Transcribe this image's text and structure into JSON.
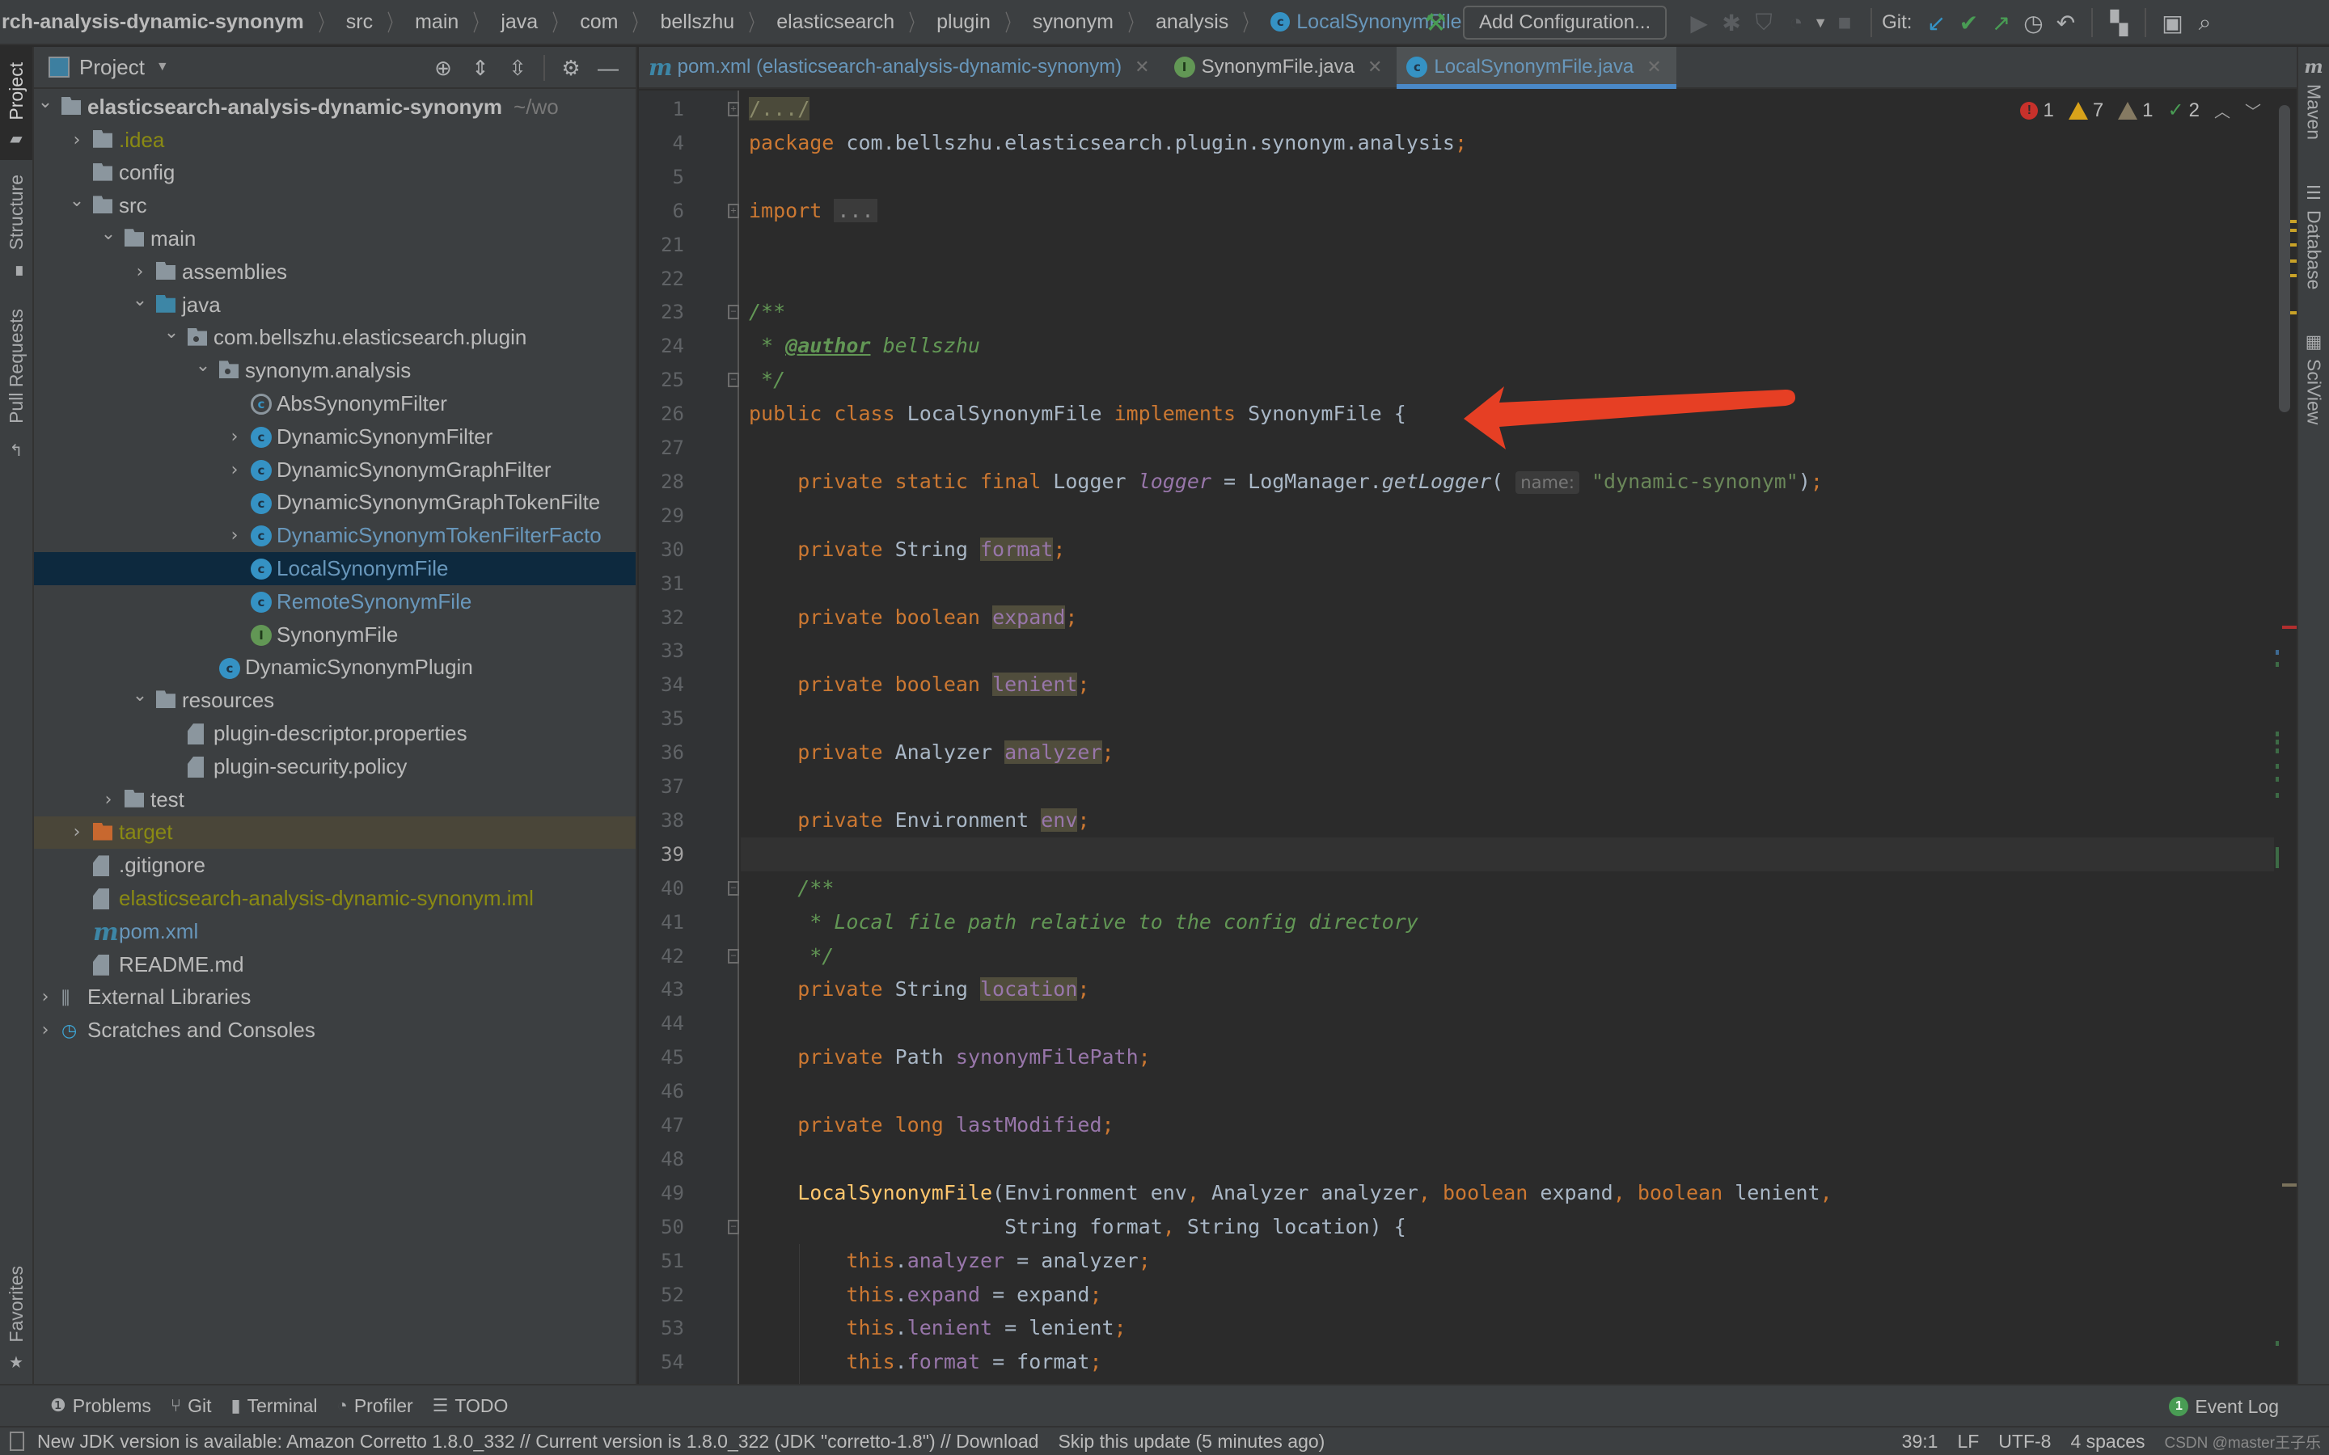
{
  "navbar": {
    "breadcrumbs": [
      "rch-analysis-dynamic-synonym",
      "src",
      "main",
      "java",
      "com",
      "bellszhu",
      "elasticsearch",
      "plugin",
      "synonym",
      "analysis"
    ],
    "current_class": "LocalSynonymFile",
    "add_configuration": "Add Configuration...",
    "git_label": "Git:",
    "icons": [
      "build-hammer-icon",
      "run-icon",
      "debug-icon",
      "coverage-icon",
      "profile-icon",
      "dropdown-icon",
      "stop-icon",
      "git-update-icon",
      "git-commit-icon",
      "git-push-icon",
      "history-icon",
      "rollback-icon",
      "project-structure-icon",
      "run-anything-icon",
      "search-everywhere-icon"
    ]
  },
  "left_strip": {
    "tabs": [
      {
        "label": "Project",
        "active": true
      },
      {
        "label": "Structure",
        "active": false
      },
      {
        "label": "Pull Requests",
        "active": false
      },
      {
        "label": "Favorites",
        "active": false
      }
    ]
  },
  "project_panel": {
    "title": "Project",
    "tree": [
      {
        "label": "elasticsearch-analysis-dynamic-synonym",
        "hint": "~/wo",
        "icon": "module-folder",
        "depth": 0,
        "expanded": true,
        "style": "bold"
      },
      {
        "label": ".idea",
        "icon": "folder",
        "depth": 1,
        "expanded": false,
        "style": "ignored"
      },
      {
        "label": "config",
        "icon": "folder",
        "depth": 1,
        "leaf": true,
        "style": "normal"
      },
      {
        "label": "src",
        "icon": "folder",
        "depth": 1,
        "expanded": true,
        "style": "normal"
      },
      {
        "label": "main",
        "icon": "folder",
        "depth": 2,
        "expanded": true,
        "style": "normal"
      },
      {
        "label": "assemblies",
        "icon": "folder",
        "depth": 3,
        "expanded": false,
        "style": "normal"
      },
      {
        "label": "java",
        "icon": "source-folder",
        "depth": 3,
        "expanded": true,
        "style": "normal"
      },
      {
        "label": "com.bellszhu.elasticsearch.plugin",
        "icon": "package",
        "depth": 4,
        "expanded": true,
        "style": "normal"
      },
      {
        "label": "synonym.analysis",
        "icon": "package",
        "depth": 5,
        "expanded": true,
        "style": "normal"
      },
      {
        "label": "AbsSynonymFilter",
        "icon": "abstract-class",
        "depth": 6,
        "leaf": true,
        "style": "normal"
      },
      {
        "label": "DynamicSynonymFilter",
        "icon": "class",
        "depth": 6,
        "expanded": false,
        "style": "normal"
      },
      {
        "label": "DynamicSynonymGraphFilter",
        "icon": "class",
        "depth": 6,
        "expanded": false,
        "style": "normal"
      },
      {
        "label": "DynamicSynonymGraphTokenFilte",
        "icon": "class",
        "depth": 6,
        "leaf": true,
        "style": "normal"
      },
      {
        "label": "DynamicSynonymTokenFilterFacto",
        "icon": "class",
        "depth": 6,
        "expanded": false,
        "style": "modified"
      },
      {
        "label": "LocalSynonymFile",
        "icon": "class",
        "depth": 6,
        "leaf": true,
        "style": "modified",
        "selected": true
      },
      {
        "label": "RemoteSynonymFile",
        "icon": "class",
        "depth": 6,
        "leaf": true,
        "style": "modified"
      },
      {
        "label": "SynonymFile",
        "icon": "interface",
        "depth": 6,
        "leaf": true,
        "style": "normal"
      },
      {
        "label": "DynamicSynonymPlugin",
        "icon": "class",
        "depth": 5,
        "leaf": true,
        "style": "normal"
      },
      {
        "label": "resources",
        "icon": "resources-folder",
        "depth": 3,
        "expanded": true,
        "style": "normal"
      },
      {
        "label": "plugin-descriptor.properties",
        "icon": "properties-file",
        "depth": 4,
        "leaf": true,
        "style": "normal"
      },
      {
        "label": "plugin-security.policy",
        "icon": "text-file",
        "depth": 4,
        "leaf": true,
        "style": "normal"
      },
      {
        "label": "test",
        "icon": "folder",
        "depth": 2,
        "expanded": false,
        "style": "normal"
      },
      {
        "label": "target",
        "icon": "excluded-folder",
        "depth": 1,
        "expanded": false,
        "style": "ignored",
        "excluded": true
      },
      {
        "label": ".gitignore",
        "icon": "ignore-file",
        "depth": 1,
        "leaf": true,
        "style": "normal"
      },
      {
        "label": "elasticsearch-analysis-dynamic-synonym.iml",
        "icon": "iml-file",
        "depth": 1,
        "leaf": true,
        "style": "ignored"
      },
      {
        "label": "pom.xml",
        "icon": "maven-file",
        "depth": 1,
        "leaf": true,
        "style": "modified"
      },
      {
        "label": "README.md",
        "icon": "markdown-file",
        "depth": 1,
        "leaf": true,
        "style": "normal"
      },
      {
        "label": "External Libraries",
        "icon": "libraries",
        "depth": 0,
        "expanded": false,
        "style": "normal"
      },
      {
        "label": "Scratches and Consoles",
        "icon": "scratches",
        "depth": 0,
        "expanded": false,
        "style": "normal"
      }
    ]
  },
  "editor_tabs": [
    {
      "label": "pom.xml (elasticsearch-analysis-dynamic-synonym)",
      "icon": "maven",
      "active": false,
      "color": "#6897bb"
    },
    {
      "label": "SynonymFile.java",
      "icon": "interface",
      "active": false,
      "color": "#bbbbbb"
    },
    {
      "label": "LocalSynonymFile.java",
      "icon": "class",
      "active": true,
      "color": "#6897bb"
    }
  ],
  "inspections": {
    "errors": "1",
    "warnings": "7",
    "weak_warnings": "1",
    "typos": "2"
  },
  "editor": {
    "current_line": 39,
    "lines": [
      {
        "n": "1",
        "fold": "+",
        "html": "<span class='folded-c'>/.../</span>"
      },
      {
        "n": "4",
        "html": "<span class='kw'>package</span> com.bellszhu.elasticsearch.plugin.synonym.analysis<span class='kw'>;</span>"
      },
      {
        "n": "5",
        "html": ""
      },
      {
        "n": "6",
        "fold": "+",
        "html": "<span class='kw'>import</span> <span class='folded'>...</span>"
      },
      {
        "n": "21",
        "html": ""
      },
      {
        "n": "22",
        "html": ""
      },
      {
        "n": "23",
        "fold": "-",
        "html": "<span class='cm'>/**</span>"
      },
      {
        "n": "24",
        "html": "<span class='cm'> * </span><span class='tag'>@author</span><span class='cm'> bellszhu</span>"
      },
      {
        "n": "25",
        "fold": "-",
        "html": "<span class='cm'> */</span>"
      },
      {
        "n": "26",
        "html": "<span class='kw'>public class</span> LocalSynonymFile <span class='kw'>implements</span> SynonymFile {"
      },
      {
        "n": "27",
        "html": ""
      },
      {
        "n": "28",
        "html": "    <span class='kw'>private static final</span> Logger <span class='fld-i'>logger</span> = LogManager.<span class='fn-i'>getLogger</span>( <span class='hint'>name:</span> <span class='str'>\"dynamic-synonym\"</span>)<span class='kw'>;</span>"
      },
      {
        "n": "29",
        "html": ""
      },
      {
        "n": "30",
        "html": "    <span class='kw'>private</span> String <span class='fld unused'>format</span><span class='kw'>;</span>"
      },
      {
        "n": "31",
        "html": ""
      },
      {
        "n": "32",
        "html": "    <span class='kw'>private boolean</span> <span class='fld unused'>expand</span><span class='kw'>;</span>"
      },
      {
        "n": "33",
        "html": ""
      },
      {
        "n": "34",
        "html": "    <span class='kw'>private boolean</span> <span class='fld unused'>lenient</span><span class='kw'>;</span>"
      },
      {
        "n": "35",
        "html": ""
      },
      {
        "n": "36",
        "html": "    <span class='kw'>private</span> Analyzer <span class='fld unused'>analyzer</span><span class='kw'>;</span>"
      },
      {
        "n": "37",
        "html": ""
      },
      {
        "n": "38",
        "html": "    <span class='kw'>private</span> Environment <span class='fld unused'>env</span><span class='kw'>;</span>"
      },
      {
        "n": "39",
        "html": ""
      },
      {
        "n": "40",
        "fold": "-",
        "html": "    <span class='cm'>/**</span>"
      },
      {
        "n": "41",
        "html": "<span class='cm'>     * Local file path relative to the config directory</span>"
      },
      {
        "n": "42",
        "fold": "-",
        "html": "<span class='cm'>     */</span>"
      },
      {
        "n": "43",
        "html": "    <span class='kw'>private</span> String <span class='fld unused'>location</span><span class='kw'>;</span>"
      },
      {
        "n": "44",
        "html": ""
      },
      {
        "n": "45",
        "html": "    <span class='kw'>private</span> Path <span class='fld'>synonymFilePath</span><span class='kw'>;</span>"
      },
      {
        "n": "46",
        "html": ""
      },
      {
        "n": "47",
        "html": "    <span class='kw'>private long</span> <span class='fld'>lastModified</span><span class='kw'>;</span>"
      },
      {
        "n": "48",
        "html": ""
      },
      {
        "n": "49",
        "html": "    <span class='ctor'>LocalSynonymFile</span>(Environment env<span class='kw'>,</span> Analyzer analyzer<span class='kw'>,</span> <span class='kw'>boolean</span> expand<span class='kw'>,</span> <span class='kw'>boolean</span> lenient<span class='kw'>,</span>"
      },
      {
        "n": "50",
        "fold": "-",
        "html": "                     String format<span class='kw'>,</span> String location) {"
      },
      {
        "n": "51",
        "html": "        <span class='kw'>this</span>.<span class='fld'>analyzer</span> = analyzer<span class='kw'>;</span>"
      },
      {
        "n": "52",
        "html": "        <span class='kw'>this</span>.<span class='fld'>expand</span> = expand<span class='kw'>;</span>"
      },
      {
        "n": "53",
        "html": "        <span class='kw'>this</span>.<span class='fld'>lenient</span> = lenient<span class='kw'>;</span>"
      },
      {
        "n": "54",
        "html": "        <span class='kw'>this</span>.<span class='fld'>format</span> = format<span class='kw'>;</span>"
      }
    ]
  },
  "right_strip": {
    "tabs": [
      {
        "label": "Maven",
        "icon": "maven-icon"
      },
      {
        "label": "Database",
        "icon": "database-icon"
      },
      {
        "label": "SciView",
        "icon": "sciview-icon"
      }
    ]
  },
  "bottom_toolbar": {
    "items": [
      {
        "label": "Problems",
        "icon": "problems-icon"
      },
      {
        "label": "Git",
        "icon": "git-icon"
      },
      {
        "label": "Terminal",
        "icon": "terminal-icon"
      },
      {
        "label": "Profiler",
        "icon": "profiler-icon"
      },
      {
        "label": "TODO",
        "icon": "todo-icon"
      }
    ],
    "event_log": {
      "label": "Event Log",
      "count": "1"
    }
  },
  "status_bar": {
    "message": "New JDK version is available: Amazon Corretto 1.8.0_332 // Current version is 1.8.0_322 (JDK \"corretto-1.8\") // Download",
    "skip": "Skip this update (5 minutes ago)",
    "position": "39:1",
    "line_sep": "LF",
    "encoding": "UTF-8",
    "indent": "4 spaces",
    "watermark": "CSDN @master王子乐"
  },
  "colors": {
    "accent": "#4a88c7",
    "annotation_arrow": "#e63f24",
    "error": "#c7312b",
    "warning": "#d8a21a"
  }
}
